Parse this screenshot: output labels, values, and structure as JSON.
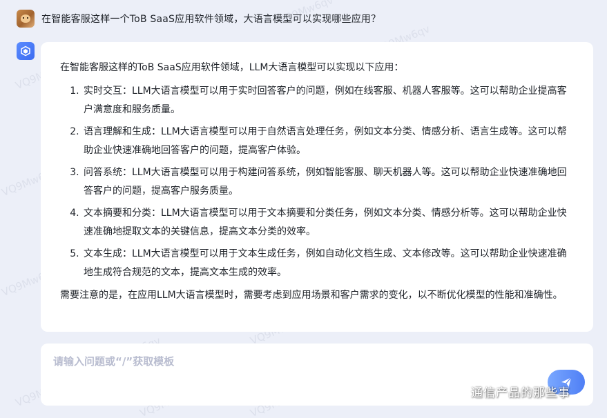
{
  "conversation": {
    "user_question": "在智能客服这样一个ToB SaaS应用软件领域，大语言模型可以实现哪些应用？",
    "answer": {
      "intro": "在智能客服这样的ToB SaaS应用软件领域，LLM大语言模型可以实现以下应用：",
      "items": [
        "实时交互：LLM大语言模型可以用于实时回答客户的问题，例如在线客服、机器人客服等。这可以帮助企业提高客户满意度和服务质量。",
        "语言理解和生成：LLM大语言模型可以用于自然语言处理任务，例如文本分类、情感分析、语言生成等。这可以帮助企业快速准确地回答客户的问题，提高客户体验。",
        "问答系统：LLM大语言模型可以用于构建问答系统，例如智能客服、聊天机器人等。这可以帮助企业快速准确地回答客户的问题，提高客户服务质量。",
        "文本摘要和分类：LLM大语言模型可以用于文本摘要和分类任务，例如文本分类、情感分析等。这可以帮助企业快速准确地提取文本的关键信息，提高文本分类的效率。",
        "文本生成：LLM大语言模型可以用于文本生成任务，例如自动化文档生成、文本修改等。这可以帮助企业快速准确地生成符合规范的文本，提高文本生成的效率。"
      ],
      "conclusion": "需要注意的是，在应用LLM大语言模型时，需要考虑到应用场景和客户需求的变化，以不断优化模型的性能和准确性。"
    }
  },
  "input": {
    "placeholder": "请输入问题或“/”获取模板",
    "value": ""
  },
  "watermark": {
    "text": "VQ9Mw6qv"
  },
  "brand": {
    "text": "通信产品的那些事"
  },
  "icons": {
    "user_avatar": "user-avatar-icon",
    "bot_avatar": "bot-cube-icon",
    "send": "send-icon",
    "brand": "wechat-icon"
  },
  "colors": {
    "background": "#eceff8",
    "card": "#ffffff",
    "accent": "#4f7ff5",
    "text": "#1f2329",
    "placeholder": "#b9bdd0"
  }
}
